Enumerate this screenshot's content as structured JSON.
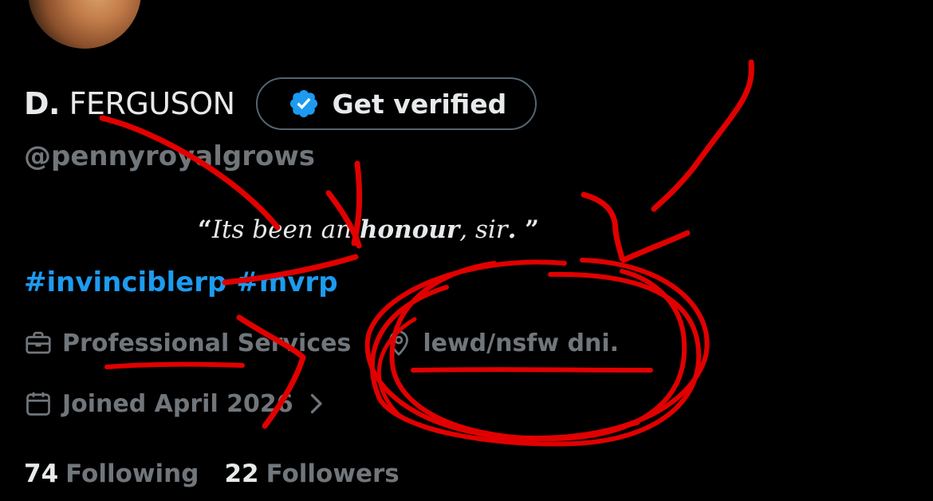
{
  "profile": {
    "display_name_first": "D.",
    "display_name_rest": "FERGUSON",
    "handle": "@pennyroyalgrows",
    "get_verified_label": "Get verified"
  },
  "bio": {
    "open_quote": "“",
    "part1": "Its been an ",
    "bold1": "honour",
    "part2": ", sir",
    "bold2": ".",
    "close_quote": " ”"
  },
  "hashtags": [
    "#invinciblerp",
    "#mvrp"
  ],
  "meta": {
    "category": "Professional Services",
    "location": "lewd/nsfw dni.",
    "joined": "Joined April 2026"
  },
  "stats": {
    "following_count": "74",
    "following_label": "Following",
    "followers_count": "22",
    "followers_label": "Followers"
  },
  "colors": {
    "background": "#000000",
    "text_primary": "#e7e9ea",
    "text_secondary": "#71767b",
    "link_blue": "#1d9bf0",
    "verified_badge": "#1d9bf0",
    "annotation_red": "#e10000"
  },
  "icons": {
    "verified": "verified-badge-icon",
    "category": "briefcase-icon",
    "location": "map-pin-icon",
    "joined": "calendar-icon",
    "joined_chevron": "chevron-right-icon"
  }
}
